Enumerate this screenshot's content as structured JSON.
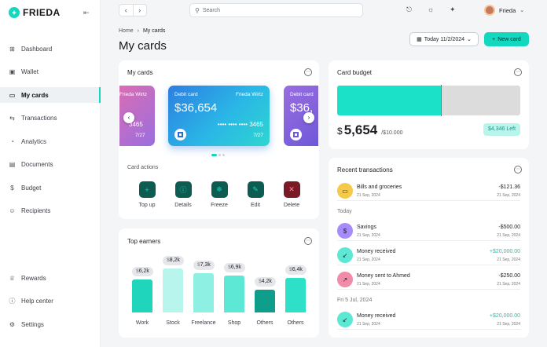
{
  "app": {
    "brand": "FRIEDA",
    "logo_letter": "✦"
  },
  "sidebar": {
    "items": [
      {
        "label": "Dashboard",
        "icon": "grid-icon",
        "glyph": "⊞"
      },
      {
        "label": "Wallet",
        "icon": "wallet-icon",
        "glyph": "▣"
      },
      {
        "label": "My cards",
        "icon": "card-icon",
        "glyph": "▭"
      },
      {
        "label": "Transactions",
        "icon": "transfer-icon",
        "glyph": "⇆"
      },
      {
        "label": "Analytics",
        "icon": "chart-icon",
        "glyph": "◔"
      },
      {
        "label": "Documents",
        "icon": "document-icon",
        "glyph": "▤"
      },
      {
        "label": "Budget",
        "icon": "dollar-icon",
        "glyph": "$"
      },
      {
        "label": "Recipients",
        "icon": "users-icon",
        "glyph": "☺"
      }
    ],
    "bottom_items": [
      {
        "label": "Rewards",
        "icon": "trophy-icon",
        "glyph": "♕"
      },
      {
        "label": "Help center",
        "icon": "info-icon",
        "glyph": "ⓘ"
      },
      {
        "label": "Settings",
        "icon": "gear-icon",
        "glyph": "⚙"
      }
    ]
  },
  "topbar": {
    "search_placeholder": "Search",
    "user_name": "Frieda"
  },
  "header": {
    "breadcrumb_home": "Home",
    "breadcrumb_sep": "›",
    "breadcrumb_current": "My cards",
    "title": "My cards",
    "date_label": "Today 11/2/2024",
    "new_card_label": "New card"
  },
  "cards_panel": {
    "title": "My cards",
    "left_card": {
      "owner": "Frieda Wirtz",
      "amount": "3465",
      "exp": "7/27"
    },
    "main_card": {
      "label": "Debit card",
      "owner": "Frieda Wirtz",
      "amount": "$36,654",
      "number": "•••• •••• •••• 3465",
      "exp": "7/27"
    },
    "right_card": {
      "label": "Debit card",
      "amount": "$36,"
    },
    "actions_title": "Card actions",
    "actions": [
      {
        "label": "Top up",
        "glyph": "+",
        "color": "#0d5c52"
      },
      {
        "label": "Details",
        "glyph": "ⓘ",
        "color": "#0d5c52"
      },
      {
        "label": "Freeze",
        "glyph": "❄",
        "color": "#0d5c52"
      },
      {
        "label": "Edit",
        "glyph": "✎",
        "color": "#0d5c52"
      },
      {
        "label": "Delete",
        "glyph": "✕",
        "color": "#7a1a24"
      }
    ]
  },
  "earners_panel": {
    "title": "Top earners",
    "items": [
      {
        "category": "Work",
        "currency": "$",
        "value": "6,2k",
        "amount_k": 6.2,
        "color": "#1fd6bd"
      },
      {
        "category": "Stock",
        "currency": "$",
        "value": "8,2k",
        "amount_k": 8.2,
        "color": "#b8f5ec"
      },
      {
        "category": "Freelance",
        "currency": "$",
        "value": "7,3k",
        "amount_k": 7.3,
        "color": "#8ef0e2"
      },
      {
        "category": "Shop",
        "currency": "$",
        "value": "6,9k",
        "amount_k": 6.9,
        "color": "#5de8d6"
      },
      {
        "category": "Others",
        "currency": "$",
        "value": "4,2k",
        "amount_k": 4.2,
        "color": "#0f9e8c"
      },
      {
        "category": "Others",
        "currency": "$",
        "value": "6,4k",
        "amount_k": 6.4,
        "color": "#2fe0c8"
      }
    ]
  },
  "budget_panel": {
    "title": "Card budget",
    "currency": "$",
    "spent": "5,654",
    "total": "/$10.000",
    "left_label": "$4,346 Left",
    "spent_fraction": 0.5654
  },
  "transactions_panel": {
    "title": "Recent transactions",
    "groups": [
      {
        "label": "",
        "items": [
          {
            "name": "Bills and groceries",
            "date": "21 Sep, 2024",
            "amount": "-$121.36",
            "time": "21 Sep, 2024",
            "positive": false,
            "icon": "card-icon",
            "glyph": "▭",
            "color": "#f7c948"
          }
        ]
      },
      {
        "label": "Today",
        "items": [
          {
            "name": "Savings",
            "date": "21 Sep, 2024",
            "amount": "-$500.00",
            "time": "21 Sep, 2024",
            "positive": false,
            "icon": "dollar-icon",
            "glyph": "$",
            "color": "#a78bfa"
          },
          {
            "name": "Money received",
            "date": "21 Sep, 2024",
            "amount": "+$20,000.00",
            "time": "21 Sep, 2024",
            "positive": true,
            "icon": "arrow-in-icon",
            "glyph": "↙",
            "color": "#5de8d6"
          },
          {
            "name": "Money sent to Ahmed",
            "date": "21 Sep, 2024",
            "amount": "-$250.00",
            "time": "21 Sep, 2024",
            "positive": false,
            "icon": "arrow-out-icon",
            "glyph": "↗",
            "color": "#f08caa"
          }
        ]
      },
      {
        "label": "Fri 5 Jul, 2024",
        "items": [
          {
            "name": "Money received",
            "date": "21 Sep, 2024",
            "amount": "+$20,000.00",
            "time": "21 Sep, 2024",
            "positive": true,
            "icon": "arrow-in-icon",
            "glyph": "↙",
            "color": "#5de8d6"
          }
        ]
      }
    ]
  }
}
